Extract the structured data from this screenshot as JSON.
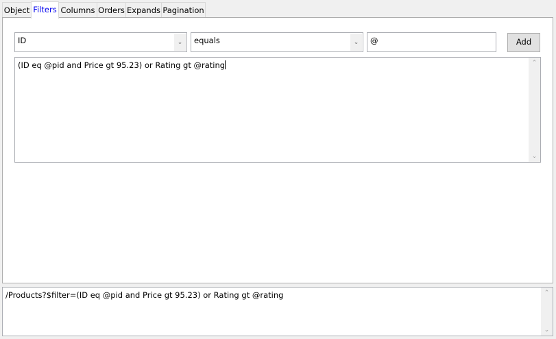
{
  "tabs": [
    {
      "label": "Object"
    },
    {
      "label": "Filters"
    },
    {
      "label": "Columns"
    },
    {
      "label": "Orders"
    },
    {
      "label": "Expands"
    },
    {
      "label": "Pagination"
    }
  ],
  "active_tab": "Filters",
  "filter": {
    "field_value": "ID",
    "operator_value": "equals",
    "value_input": "@",
    "add_label": "Add",
    "expression": "(ID eq @pid and Price gt 95.23) or Rating gt @rating"
  },
  "output": {
    "query": "/Products?$filter=(ID eq @pid and Price gt 95.23) or Rating gt @rating"
  }
}
